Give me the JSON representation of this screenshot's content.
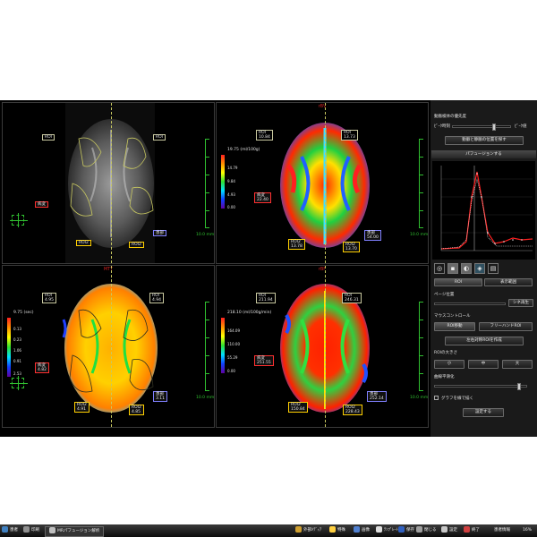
{
  "viewer": {
    "panes": [
      {
        "id": "p1",
        "title": "",
        "rois": [
          {
            "label": "ROI",
            "value": ""
          },
          {
            "label": "ROI",
            "value": ""
          },
          {
            "label": "病変",
            "value": ""
          },
          {
            "label": "ROI2",
            "value": ""
          },
          {
            "label": "ROI2",
            "value": ""
          },
          {
            "label": "患部",
            "value": ""
          }
        ]
      },
      {
        "id": "p2",
        "title": "rBV",
        "colorbar": {
          "unit": "19.75 (ml/100g)",
          "values": [
            "14.79",
            "9.84",
            "4.93",
            "0.00"
          ]
        },
        "rois": [
          {
            "label": "ROI",
            "value": "10.84"
          },
          {
            "label": "ROI",
            "value": "13.73"
          },
          {
            "label": "病変",
            "value": "22.40"
          },
          {
            "label": "ROI2",
            "value": "13.78"
          },
          {
            "label": "ROI2",
            "value": "13.70"
          },
          {
            "label": "患部",
            "value": "54.00"
          }
        ],
        "ruler": "10.0 mm"
      },
      {
        "id": "p3",
        "title": "MTT",
        "colorbar": {
          "unit": "9.75 (sec)",
          "values": [
            "0.13",
            "0.23",
            "1.06",
            "0.91",
            "2.53"
          ]
        },
        "rois": [
          {
            "label": "ROI",
            "value": "4.95"
          },
          {
            "label": "ROI",
            "value": "4.94"
          },
          {
            "label": "病変",
            "value": "4.82"
          },
          {
            "label": "ROI2",
            "value": "4.91"
          },
          {
            "label": "ROI2",
            "value": "4.85"
          },
          {
            "label": "患部",
            "value": "3.11"
          }
        ],
        "ruler": "10.0 mm"
      },
      {
        "id": "p4",
        "title": "rBF",
        "colorbar": {
          "unit": "218.10 (ml/100g/min)",
          "values": [
            "164.09",
            "110.00",
            "55.29",
            "0.00"
          ]
        },
        "rois": [
          {
            "label": "ROI",
            "value": "211.94"
          },
          {
            "label": "ROI",
            "value": "246.31"
          },
          {
            "label": "病変",
            "value": "251.55"
          },
          {
            "label": "ROI2",
            "value": "150.84"
          },
          {
            "label": "ROI2",
            "value": "228.43"
          },
          {
            "label": "患部",
            "value": "252.14"
          }
        ],
        "ruler": "10.0 mm"
      }
    ],
    "pane1_ruler": "10.0 mm"
  },
  "side": {
    "label_interval": "動脈検体の優先度",
    "slider_left": "ﾋﾟｰｸ時刻",
    "slider_right": "ﾋﾟｰｸ値",
    "btn_find": "動脈と静脈の位置を探す",
    "btn_perfusion": "パフュージョンする",
    "tab_roi": "ROI",
    "tab_display": "表示範囲",
    "label_page": "ページ位置",
    "btn_cine": "シネ再生",
    "label_mouse": "マウスコントロール",
    "btn_roi_move": "ROI移動",
    "btn_freehand": "フリーハンドROI",
    "btn_roi_all": "左右対称ROIを作成",
    "label_roi_size": "ROIの大きさ",
    "size_small": "小",
    "size_mid": "中",
    "size_large": "大",
    "label_smooth": "曲線平滑化",
    "label_graph": "グラフを線で描く",
    "btn_settings": "設定する"
  },
  "taskbar": {
    "items": [
      "患者",
      "印刷",
      "MRパフュージョン解析",
      "外部ﾒﾃﾞｨｱ",
      "特殊",
      "画像",
      "ﾃﾝﾌﾟﾚｰﾄ",
      "保存",
      "閉じる",
      "設定",
      "終了"
    ],
    "right": "患者情報",
    "zoom": "16%"
  }
}
